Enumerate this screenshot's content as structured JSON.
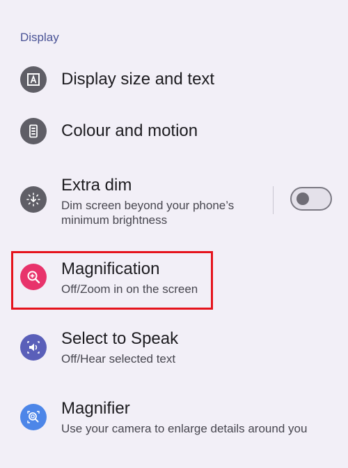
{
  "section": {
    "title": "Display"
  },
  "items": [
    {
      "title": "Display size and text",
      "subtitle": "",
      "icon": "text-size-icon",
      "icon_color": "#5f5e66"
    },
    {
      "title": "Colour and motion",
      "subtitle": "",
      "icon": "phone-color-icon",
      "icon_color": "#5f5e66"
    },
    {
      "title": "Extra dim",
      "subtitle_line1": "Dim screen beyond your phone’s",
      "subtitle_line2": "minimum brightness",
      "icon": "brightness-icon",
      "icon_color": "#5f5e66",
      "toggle_on": false
    },
    {
      "title": "Magnification",
      "subtitle": "Off/Zoom in on the screen",
      "icon": "zoom-in-icon",
      "icon_color": "#e8336b"
    },
    {
      "title": "Select to Speak",
      "subtitle": "Off/Hear selected text",
      "icon": "speaker-icon",
      "icon_color": "#5a5fb9"
    },
    {
      "title": "Magnifier",
      "subtitle": "Use your camera to enlarge details around you",
      "icon": "magnifier-icon",
      "icon_color": "#4d86e8"
    }
  ],
  "colors": {
    "background": "#f2eff7",
    "accent": "#4a5396",
    "highlight": "#e5131c"
  }
}
